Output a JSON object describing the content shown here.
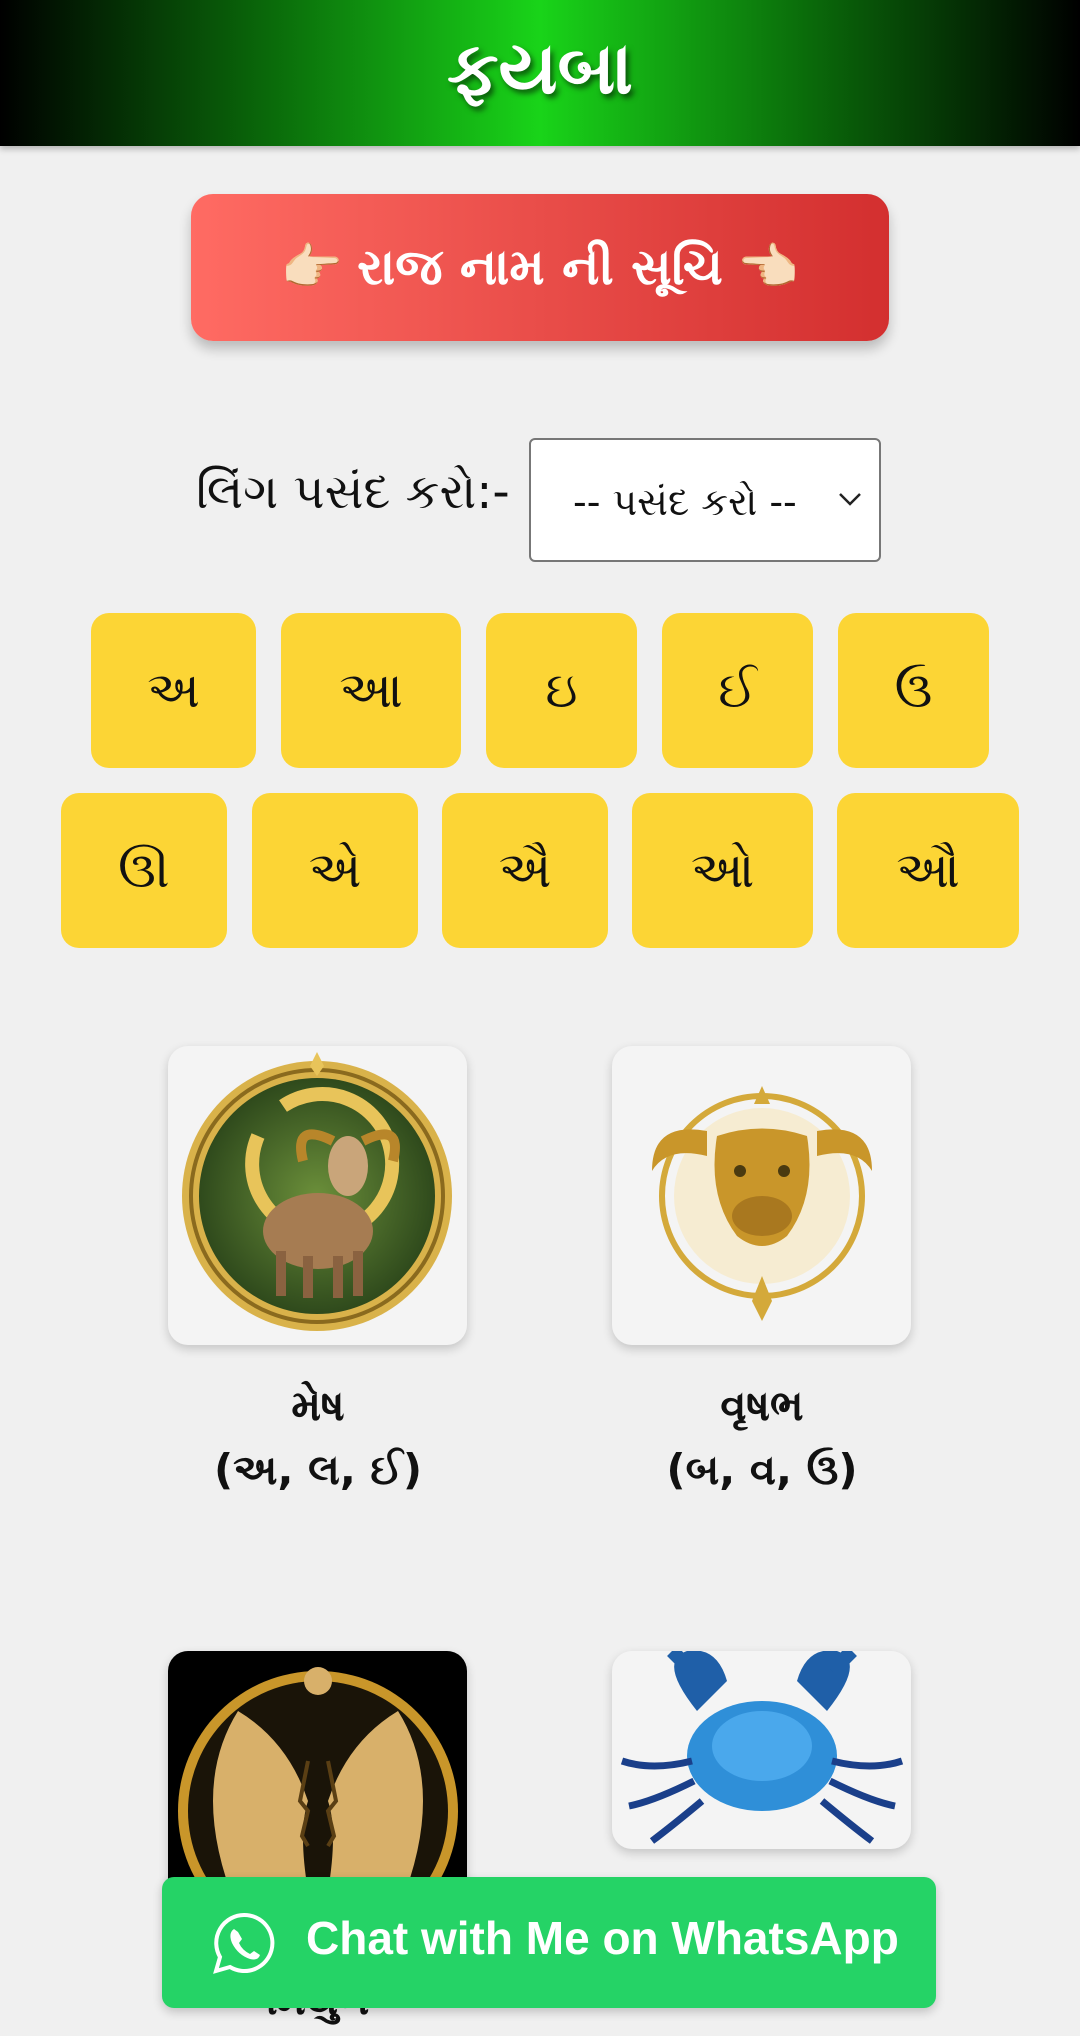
{
  "header": {
    "title": "ફયબા"
  },
  "raj_button": {
    "hand_left": "👉🏻",
    "label": "રાજ નામ ની સૂચિ",
    "hand_right": "👈🏻"
  },
  "gender": {
    "label": "લિંગ પસંદ કરો:-",
    "selected": "-- પસંદ કરો --"
  },
  "letters": {
    "row1": [
      "અ",
      "આ",
      "ઇ",
      "ઈ",
      "ઉ"
    ],
    "row2": [
      "ઊ",
      "એ",
      "ઐ",
      "ઓ",
      "ઔ"
    ]
  },
  "signs": [
    {
      "name": "મેષ",
      "letters": "(અ, લ, ઈ)",
      "icon": "ram-icon"
    },
    {
      "name": "વૃષભ",
      "letters": "(બ, વ, ઉ)",
      "icon": "bull-icon"
    },
    {
      "name": "મિથુન",
      "letters": "",
      "icon": "twins-icon"
    },
    {
      "name": "",
      "letters": "",
      "icon": "crab-icon"
    }
  ],
  "whatsapp": {
    "label": "Chat with Me on WhatsApp",
    "color": "#25d366"
  },
  "colors": {
    "letter_bg": "#fcd535",
    "raj_button": "#e53935",
    "header_center": "#19d419"
  }
}
